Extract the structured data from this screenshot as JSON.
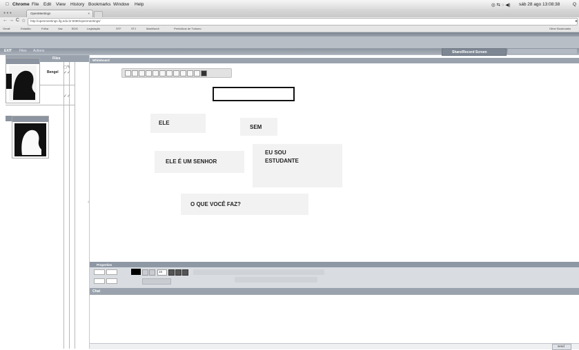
{
  "menubar": {
    "app": "Chrome",
    "items": [
      "File",
      "Edit",
      "View",
      "History",
      "Bookmarks",
      "Window",
      "Help"
    ],
    "clock": "sáb 28 ago 13:08:38"
  },
  "browser": {
    "tab_title": "OpenMeetings",
    "url": "http://openmeetings.ifg.edu.br:5080/openmeetings/",
    "bookmarks": [
      "Gmail",
      "Estadão",
      "Folha",
      "Vaz",
      "BOG",
      "Legislação",
      "STF",
      "STJ",
      "MaxMundi",
      "Periódicos de Turismo"
    ],
    "other_bookmarks": "Other Bookmarks"
  },
  "app": {
    "nav_items": [
      "EXIT",
      "Files",
      "Actions"
    ],
    "share_button": "Share/Record Screen",
    "wb_tab": "Whiteboard",
    "files_tab": "Files",
    "user1_name": "Bengel",
    "props_title": "Properties",
    "chat_title": "Chat"
  },
  "whiteboard": {
    "items": [
      {
        "text": "ELE"
      },
      {
        "text": "SEM"
      },
      {
        "text": "ELE É UM SENHOR"
      },
      {
        "text": "EU SOU\nESTUDANTE"
      },
      {
        "text": "O QUE VOCÊ FAZ?"
      }
    ]
  },
  "props": {
    "font_size": "16"
  },
  "chat": {
    "send_label": "send"
  }
}
